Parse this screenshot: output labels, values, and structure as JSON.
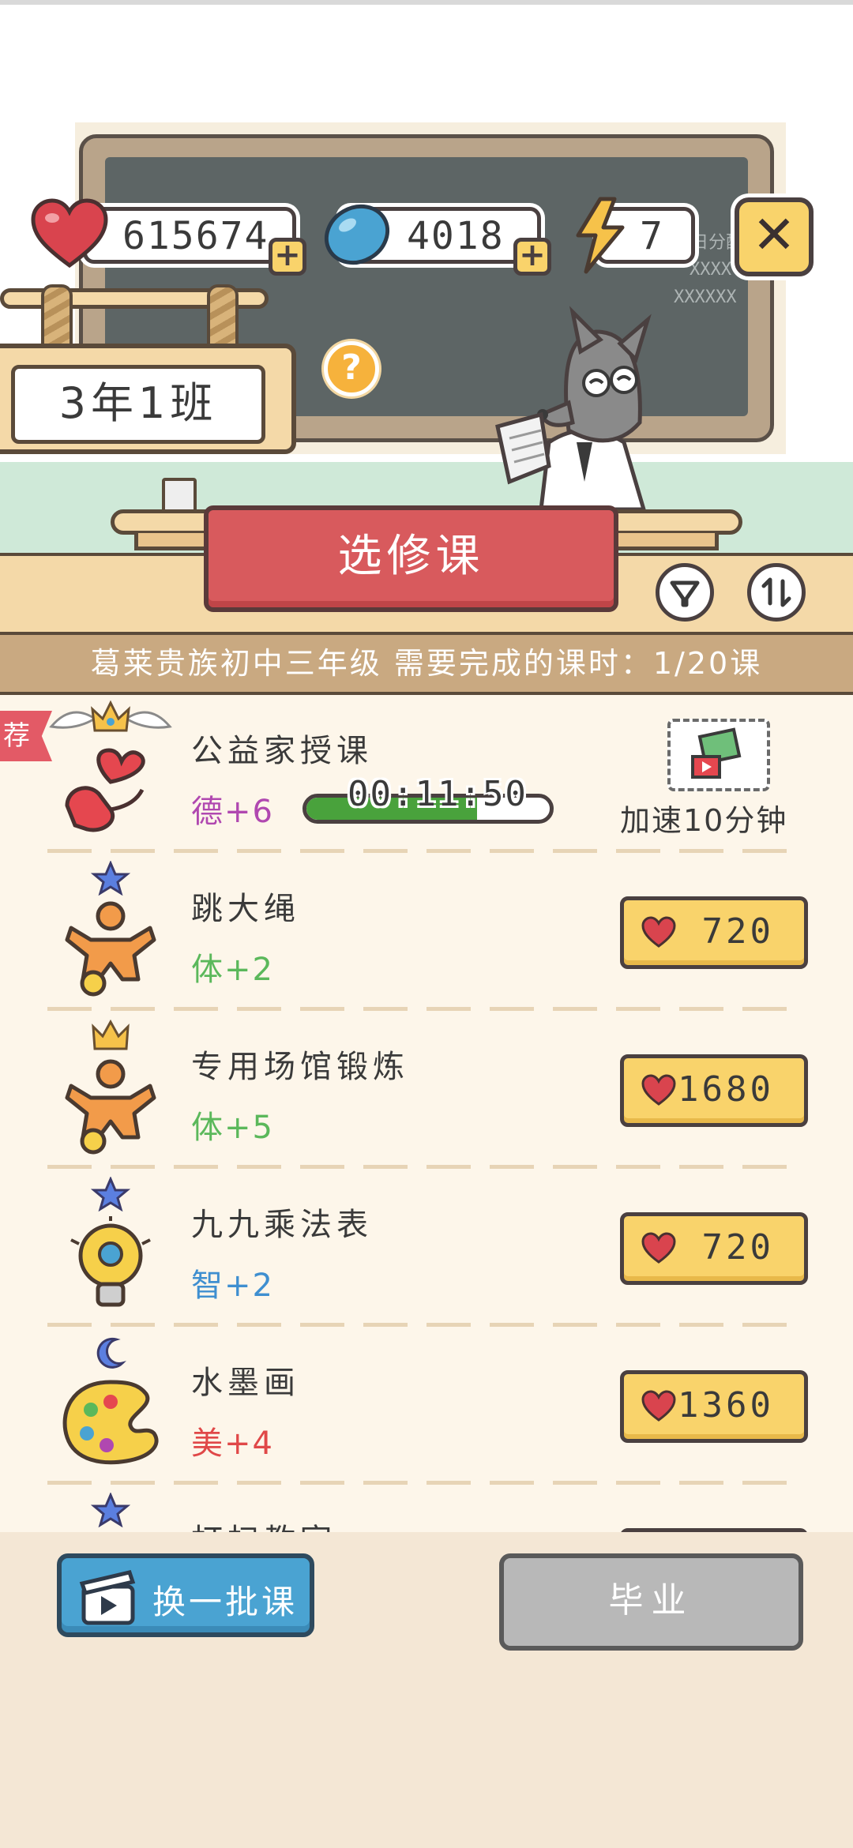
{
  "currencies": {
    "hearts": "615674",
    "gems": "4018",
    "energy": "7"
  },
  "class_sign": "3年1班",
  "help_label": "?",
  "elective_title": "选修课",
  "info_text": "葛莱贵族初中三年级 需要完成的课时：1/20课",
  "chalkboard": {
    "line1": "值日分配",
    "line2": "XXXX",
    "line3": "XXXXXX"
  },
  "recommend_tag": "荐",
  "featured": {
    "name": "公益家授课",
    "stat": "德+6",
    "stat_color": "#b048b0",
    "timer": "00:11:50",
    "progress": 0.7,
    "speedup_label": "加速10分钟"
  },
  "courses": [
    {
      "name": "跳大绳",
      "stat": "体+2",
      "stat_color": "#5bb85b",
      "price": "720",
      "badge": "star-icon"
    },
    {
      "name": "专用场馆锻炼",
      "stat": "体+5",
      "stat_color": "#5bb85b",
      "price": "1680",
      "badge": "crown-icon"
    },
    {
      "name": "九九乘法表",
      "stat": "智+2",
      "stat_color": "#3f8fd0",
      "price": "720",
      "badge": "star-icon"
    },
    {
      "name": "水墨画",
      "stat": "美+4",
      "stat_color": "#e04848",
      "price": "1360",
      "badge": "moon-icon"
    },
    {
      "name": "打扫教室",
      "stat": "",
      "stat_color": "#5bb85b",
      "price": "",
      "badge": "star-icon"
    }
  ],
  "buttons": {
    "refresh": "换一批课",
    "graduate": "毕业",
    "close": "✕"
  },
  "colors": {
    "heart": "#d9444e",
    "gem": "#4aa3d2",
    "price_button": "#f9d36b",
    "elective_banner": "#d85a5d"
  }
}
